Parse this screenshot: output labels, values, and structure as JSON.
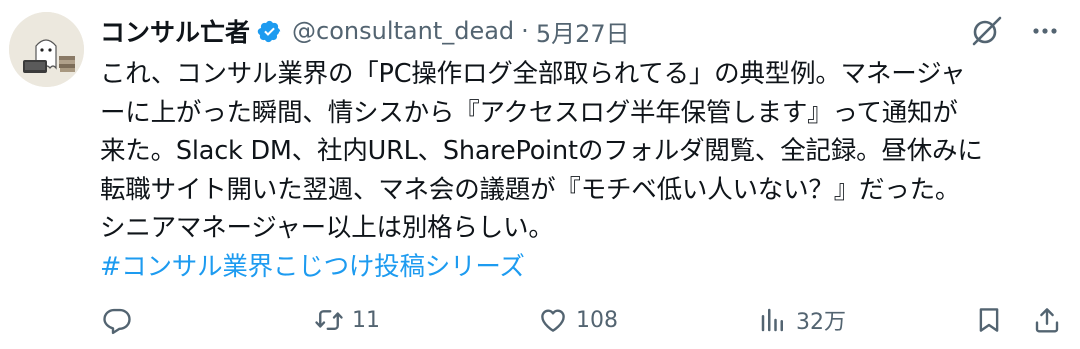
{
  "tweet": {
    "author_name": "コンサル亡者",
    "handle": "@consultant_dead",
    "separator": "·",
    "date": "5月27日",
    "body_lines": [
      "これ、コンサル業界の「PC操作ログ全部取られてる」の典型例。マネージャ",
      "ーに上がった瞬間、情シスから『アクセスログ半年保管します』って通知が",
      "来た。Slack DM、社内URL、SharePointのフォルダ閲覧、全記録。昼休みに",
      "転職サイト開いた翌週、マネ会の議題が『モチベ低い人いない？』だった。",
      "シニアマネージャー以上は別格らしい。"
    ],
    "hashtag": "#コンサル業界こじつけ投稿シリーズ"
  },
  "actions": {
    "reply_count": "",
    "retweet_count": "11",
    "like_count": "108",
    "views_count": "32万"
  },
  "icons": {
    "verified": "verified-badge-icon",
    "grok": "grok-icon",
    "more": "more-icon",
    "reply": "reply-icon",
    "retweet": "retweet-icon",
    "like": "like-icon",
    "views": "views-icon",
    "bookmark": "bookmark-icon",
    "share": "share-icon"
  },
  "colors": {
    "accent": "#1d9bf0",
    "muted": "#536471",
    "text": "#0f1419"
  }
}
